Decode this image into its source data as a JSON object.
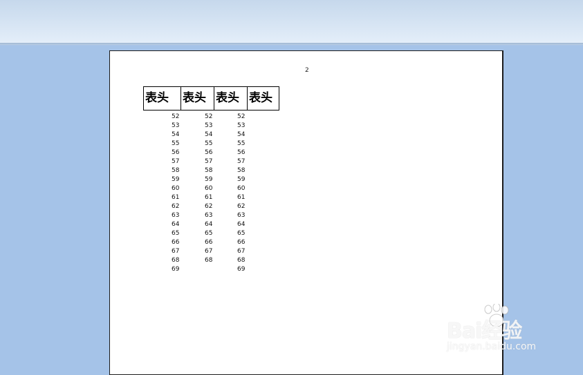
{
  "document": {
    "page_number": "2",
    "headers": [
      "表头",
      "表头",
      "表头",
      "表头"
    ],
    "columns": [
      [
        "52",
        "53",
        "54",
        "55",
        "56",
        "57",
        "58",
        "59",
        "60",
        "61",
        "62",
        "63",
        "64",
        "65",
        "66",
        "67",
        "68",
        "69"
      ],
      [
        "52",
        "53",
        "54",
        "55",
        "56",
        "57",
        "58",
        "59",
        "60",
        "61",
        "62",
        "63",
        "64",
        "65",
        "66",
        "67",
        "68"
      ],
      [
        "52",
        "53",
        "54",
        "55",
        "56",
        "57",
        "58",
        "59",
        "60",
        "61",
        "62",
        "63",
        "64",
        "65",
        "66",
        "67",
        "68",
        "69"
      ]
    ]
  },
  "watermark": {
    "brand": "Bai经验",
    "url": "jingyan.baidu.com"
  }
}
